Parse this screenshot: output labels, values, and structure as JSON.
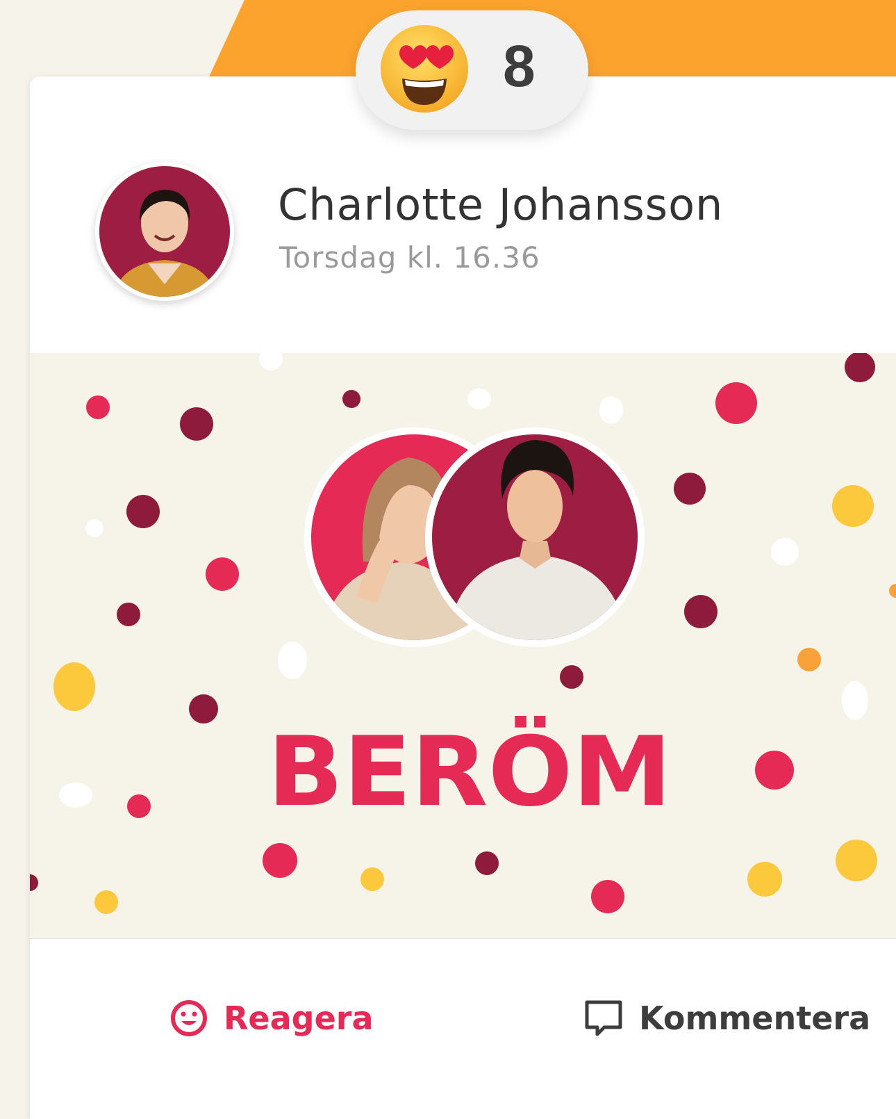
{
  "reaction": {
    "emoji_icon": "heart-eyes-emoji-icon",
    "count": "8"
  },
  "post": {
    "author_name": "Charlotte Johansson",
    "timestamp": "Torsdag kl. 16.36",
    "banner_title": "BERÖM"
  },
  "actions": {
    "react_label": "Reagera",
    "react_icon": "smiley-icon",
    "comment_label": "Kommentera",
    "comment_icon": "speech-bubble-icon"
  },
  "colors": {
    "accent_orange": "#fca32e",
    "brand_red": "#e42a55",
    "dark_red": "#8e1b3c",
    "yellow": "#fcc93c",
    "cream": "#f6f3e8"
  }
}
